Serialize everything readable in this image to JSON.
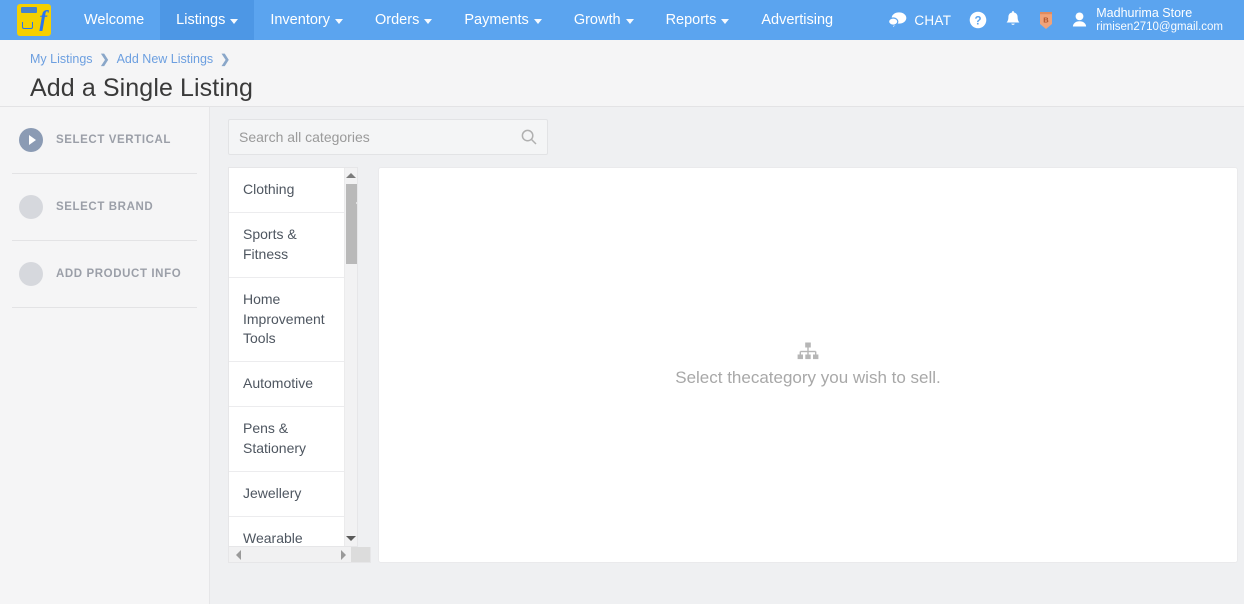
{
  "topnav": {
    "logo_alt": "flipkart-logo",
    "items": [
      {
        "label": "Welcome",
        "has_caret": false,
        "active": false
      },
      {
        "label": "Listings",
        "has_caret": true,
        "active": true
      },
      {
        "label": "Inventory",
        "has_caret": true,
        "active": false
      },
      {
        "label": "Orders",
        "has_caret": true,
        "active": false
      },
      {
        "label": "Payments",
        "has_caret": true,
        "active": false
      },
      {
        "label": "Growth",
        "has_caret": true,
        "active": false
      },
      {
        "label": "Reports",
        "has_caret": true,
        "active": false
      },
      {
        "label": "Advertising",
        "has_caret": false,
        "active": false
      }
    ],
    "chat_label": "CHAT",
    "chat_icon": "chat-bubbles-icon",
    "help_icon": "help-circle-icon",
    "bell_icon": "notification-bell-icon",
    "badge_icon": "bronze-tier-shield-icon",
    "badge_letter": "B",
    "avatar_icon": "user-avatar-icon",
    "user_name": "Madhurima Store",
    "user_email": "rimisen2710@gmail.com",
    "bg_color": "#5ba4ef",
    "active_bg_color": "#4d97e5"
  },
  "breadcrumb": {
    "items": [
      "My Listings",
      "Add New Listings"
    ],
    "separator": "❯",
    "link_color": "#6c9fe0"
  },
  "page": {
    "title": "Add a Single Listing"
  },
  "steps": [
    {
      "label": "SELECT VERTICAL",
      "state": "current",
      "icon": "chevron-right-icon"
    },
    {
      "label": "SELECT BRAND",
      "state": "pending",
      "icon": "step-dot-icon"
    },
    {
      "label": "ADD PRODUCT INFO",
      "state": "pending",
      "icon": "step-dot-icon"
    }
  ],
  "search": {
    "placeholder": "Search all categories",
    "value": "",
    "icon": "search-icon"
  },
  "categories": {
    "items": [
      "Clothing",
      "Sports & Fitness",
      "Home Improvement Tools",
      "Automotive",
      "Pens & Stationery",
      "Jewellery",
      "Wearable"
    ],
    "scroll_up_icon": "scroll-up-arrow-icon",
    "scroll_down_icon": "scroll-down-arrow-icon",
    "scroll_left_icon": "scroll-left-arrow-icon",
    "scroll_right_icon": "scroll-right-arrow-icon"
  },
  "detail_panel": {
    "empty_icon": "sitemap-hierarchy-icon",
    "empty_text": "Select thecategory you wish to sell."
  }
}
